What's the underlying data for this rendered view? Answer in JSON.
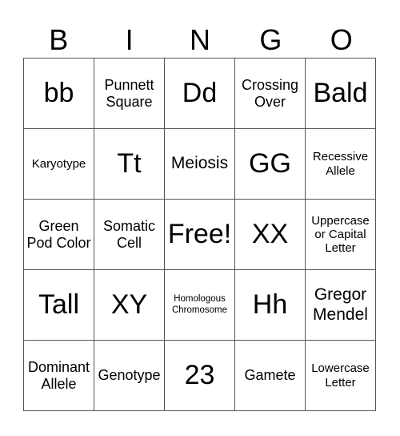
{
  "header": [
    "B",
    "I",
    "N",
    "G",
    "O"
  ],
  "cells": [
    {
      "text": "bb",
      "size": "xl"
    },
    {
      "text": "Punnett Square",
      "size": "md"
    },
    {
      "text": "Dd",
      "size": "xl"
    },
    {
      "text": "Crossing Over",
      "size": "md"
    },
    {
      "text": "Bald",
      "size": "xl"
    },
    {
      "text": "Karyotype",
      "size": "sm"
    },
    {
      "text": "Tt",
      "size": "xl"
    },
    {
      "text": "Meiosis",
      "size": "lg"
    },
    {
      "text": "GG",
      "size": "xl"
    },
    {
      "text": "Recessive Allele",
      "size": "sm"
    },
    {
      "text": "Green Pod Color",
      "size": "md"
    },
    {
      "text": "Somatic Cell",
      "size": "md"
    },
    {
      "text": "Free!",
      "size": "xl"
    },
    {
      "text": "XX",
      "size": "xl"
    },
    {
      "text": "Uppercase or Capital Letter",
      "size": "sm"
    },
    {
      "text": "Tall",
      "size": "xl"
    },
    {
      "text": "XY",
      "size": "xl"
    },
    {
      "text": "Homologous Chromosome",
      "size": "xs"
    },
    {
      "text": "Hh",
      "size": "xl"
    },
    {
      "text": "Gregor Mendel",
      "size": "lg"
    },
    {
      "text": "Dominant Allele",
      "size": "md"
    },
    {
      "text": "Genotype",
      "size": "md"
    },
    {
      "text": "23",
      "size": "xl"
    },
    {
      "text": "Gamete",
      "size": "md"
    },
    {
      "text": "Lowercase Letter",
      "size": "sm"
    }
  ]
}
